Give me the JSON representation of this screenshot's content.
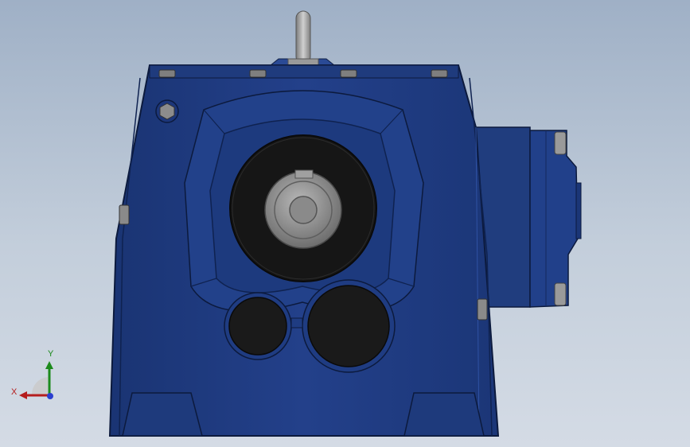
{
  "viewport": {
    "background_top": "#9fb0c6",
    "background_bottom": "#d4dbe5"
  },
  "model": {
    "body_color": "#203d7e",
    "body_dark": "#172f66",
    "bore_color": "#141414",
    "shaft_color": "#8e8e8e"
  },
  "triad": {
    "y_label": "Y",
    "x_label": "X",
    "y_color": "#1c8a1c",
    "x_color": "#b51d1d",
    "z_color": "#2a3fcf"
  }
}
